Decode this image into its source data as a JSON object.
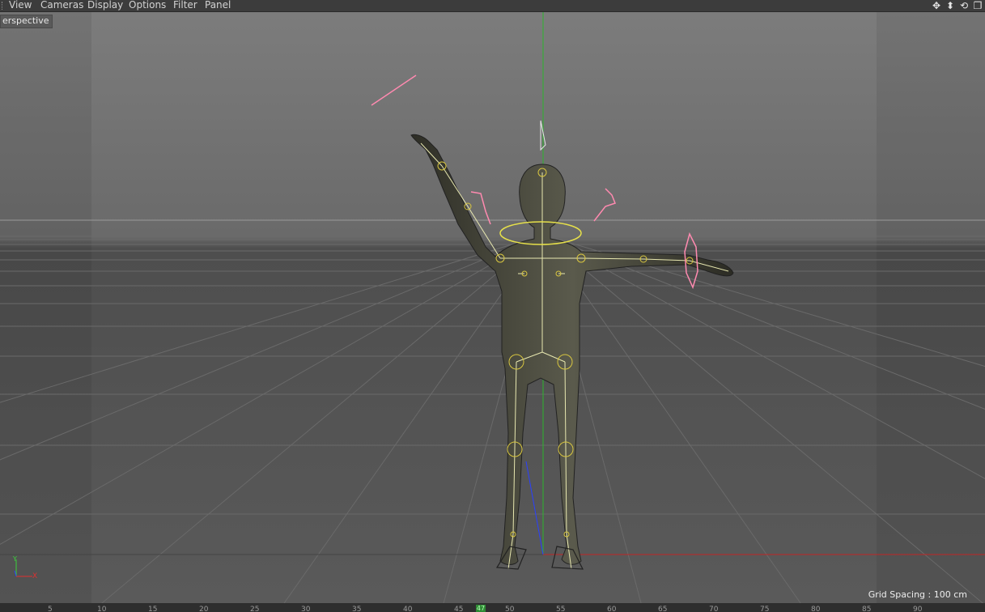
{
  "menubar": {
    "items": [
      "View",
      "Cameras",
      "Display",
      "Options",
      "Filter",
      "Panel"
    ],
    "nav_icons": [
      "move-icon",
      "dolly-icon",
      "rotate-icon",
      "maximize-icon"
    ]
  },
  "viewport": {
    "camera_label": "erspective",
    "grid_spacing": "Grid Spacing : 100 cm",
    "axis_y": "Y",
    "axis_x": "X"
  },
  "timeline": {
    "ticks": [
      "5",
      "10",
      "15",
      "20",
      "25",
      "30",
      "35",
      "40",
      "45",
      "50",
      "55",
      "60",
      "65",
      "70",
      "75",
      "80",
      "85",
      "90"
    ],
    "current_frame": "47"
  },
  "colors": {
    "bone": "#e8e8b0",
    "ik_handle": "#ff8ab0",
    "y_axis": "#3bd13b",
    "x_axis": "#e03030",
    "z_axis": "#2a40ff"
  }
}
